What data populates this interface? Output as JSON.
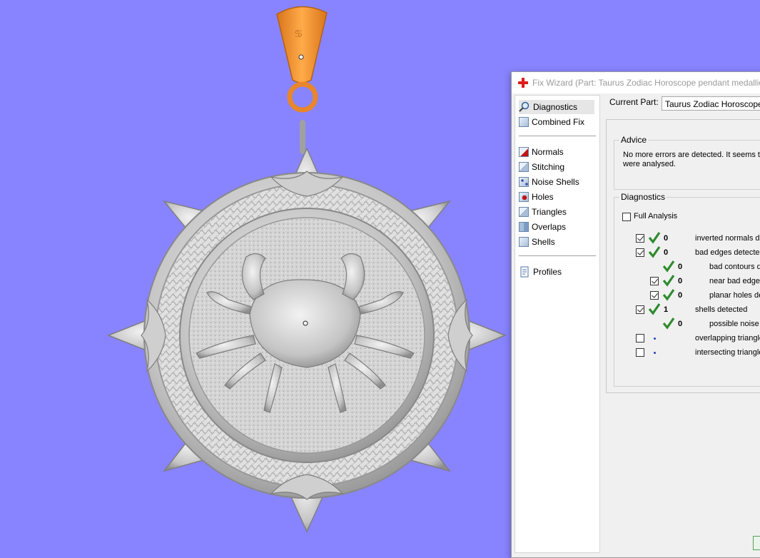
{
  "window": {
    "title": "Fix Wizard (Part: Taurus Zodiac Horoscope pendant medallion",
    "current_part_label": "Current Part:",
    "current_part_value": "Taurus Zodiac Horoscope pe"
  },
  "nav": {
    "items": [
      {
        "label": "Diagnostics",
        "icon": "magnifier-icon"
      },
      {
        "label": "Combined Fix",
        "icon": "cube-icon"
      },
      {
        "label": "Normals",
        "icon": "normals-icon"
      },
      {
        "label": "Stitching",
        "icon": "stitching-icon"
      },
      {
        "label": "Noise Shells",
        "icon": "noise-shells-icon"
      },
      {
        "label": "Holes",
        "icon": "holes-icon"
      },
      {
        "label": "Triangles",
        "icon": "triangles-icon"
      },
      {
        "label": "Overlaps",
        "icon": "overlaps-icon"
      },
      {
        "label": "Shells",
        "icon": "shells-icon"
      },
      {
        "label": "Profiles",
        "icon": "profiles-icon"
      }
    ]
  },
  "advice": {
    "title": "Advice",
    "text_line1": "No more errors are detected. It seems th",
    "text_line2": "were analysed."
  },
  "diagnostics": {
    "title": "Diagnostics",
    "full_analysis_label": "Full Analysis",
    "rows": [
      {
        "count": "0",
        "label": "inverted normals de"
      },
      {
        "count": "0",
        "label": "bad edges detected"
      },
      {
        "count": "0",
        "label": "bad contours d"
      },
      {
        "count": "0",
        "label": "near bad edges"
      },
      {
        "count": "0",
        "label": "planar holes de"
      },
      {
        "count": "1",
        "label": "shells detected"
      },
      {
        "count": "0",
        "label": "possible noise s"
      },
      {
        "count": "",
        "label": "overlapping triangle"
      },
      {
        "count": "",
        "label": "intersecting triangle"
      }
    ]
  },
  "colors": {
    "viewport_background": "#8884ff",
    "model_silver": "#c9c9c9",
    "bail_orange": "#f5962c",
    "check_green": "#2e8b2e"
  }
}
